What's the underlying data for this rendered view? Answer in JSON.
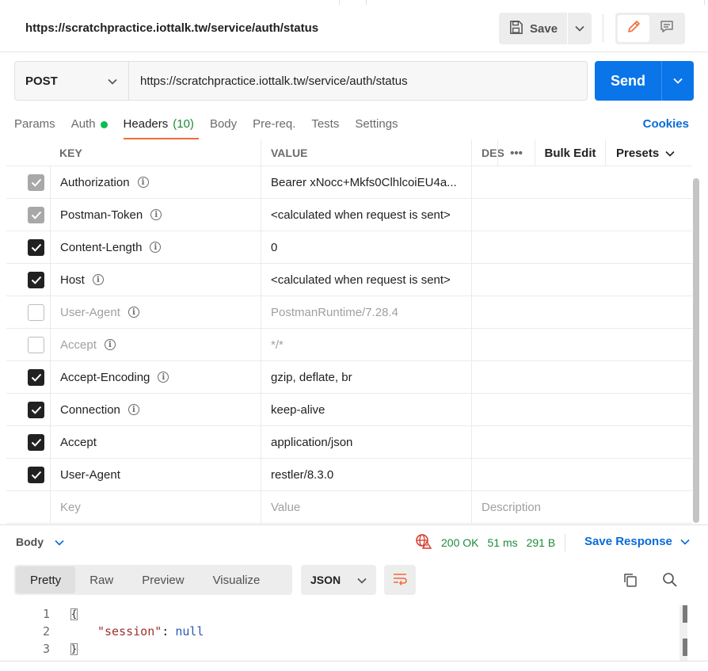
{
  "request": {
    "title": "https://scratchpractice.iottalk.tw/service/auth/status",
    "method": "POST",
    "url": "https://scratchpractice.iottalk.tw/service/auth/status"
  },
  "toolbar": {
    "save_label": "Save",
    "send_label": "Send"
  },
  "tabs": [
    {
      "label": "Params"
    },
    {
      "label": "Auth"
    },
    {
      "label": "Headers",
      "count": "(10)"
    },
    {
      "label": "Body"
    },
    {
      "label": "Pre-req."
    },
    {
      "label": "Tests"
    },
    {
      "label": "Settings"
    }
  ],
  "cookies_label": "Cookies",
  "headers_table": {
    "columns": {
      "key": "KEY",
      "value": "VALUE",
      "description": "DES"
    },
    "bulk_edit": "Bulk Edit",
    "presets": "Presets",
    "more": "•••",
    "rows": [
      {
        "key": "Authorization",
        "value": "Bearer xNocc+Mkfs0ClhlcoiEU4a...",
        "state": "grey",
        "info": true
      },
      {
        "key": "Postman-Token",
        "value": "<calculated when request is sent>",
        "state": "grey",
        "info": true
      },
      {
        "key": "Content-Length",
        "value": "0",
        "state": "on",
        "info": true
      },
      {
        "key": "Host",
        "value": "<calculated when request is sent>",
        "state": "on",
        "info": true
      },
      {
        "key": "User-Agent",
        "value": "PostmanRuntime/7.28.4",
        "state": "off",
        "info": true
      },
      {
        "key": "Accept",
        "value": "*/*",
        "state": "off",
        "info": true
      },
      {
        "key": "Accept-Encoding",
        "value": "gzip, deflate, br",
        "state": "on",
        "info": true
      },
      {
        "key": "Connection",
        "value": "keep-alive",
        "state": "on",
        "info": true
      },
      {
        "key": "Accept",
        "value": "application/json",
        "state": "on",
        "info": false
      },
      {
        "key": "User-Agent",
        "value": "restler/8.3.0",
        "state": "on",
        "info": false
      }
    ],
    "placeholder": {
      "key": "Key",
      "value": "Value",
      "description": "Description"
    }
  },
  "response": {
    "label": "Body",
    "status": "200 OK",
    "time": "51 ms",
    "size": "291 B",
    "save_label": "Save Response",
    "formats": [
      "Pretty",
      "Raw",
      "Preview",
      "Visualize"
    ],
    "language": "JSON",
    "code_lines": [
      {
        "num": "1",
        "text": "{"
      },
      {
        "num": "2",
        "key": "\"session\"",
        "colon": ":",
        "value": "null"
      },
      {
        "num": "3",
        "text": "}"
      }
    ]
  },
  "colors": {
    "accent": "#f26b3a",
    "send": "#0a75e8",
    "link": "#0a6bd8",
    "status_ok": "#1f8a3a",
    "auth_dot": "#0cbb52"
  }
}
